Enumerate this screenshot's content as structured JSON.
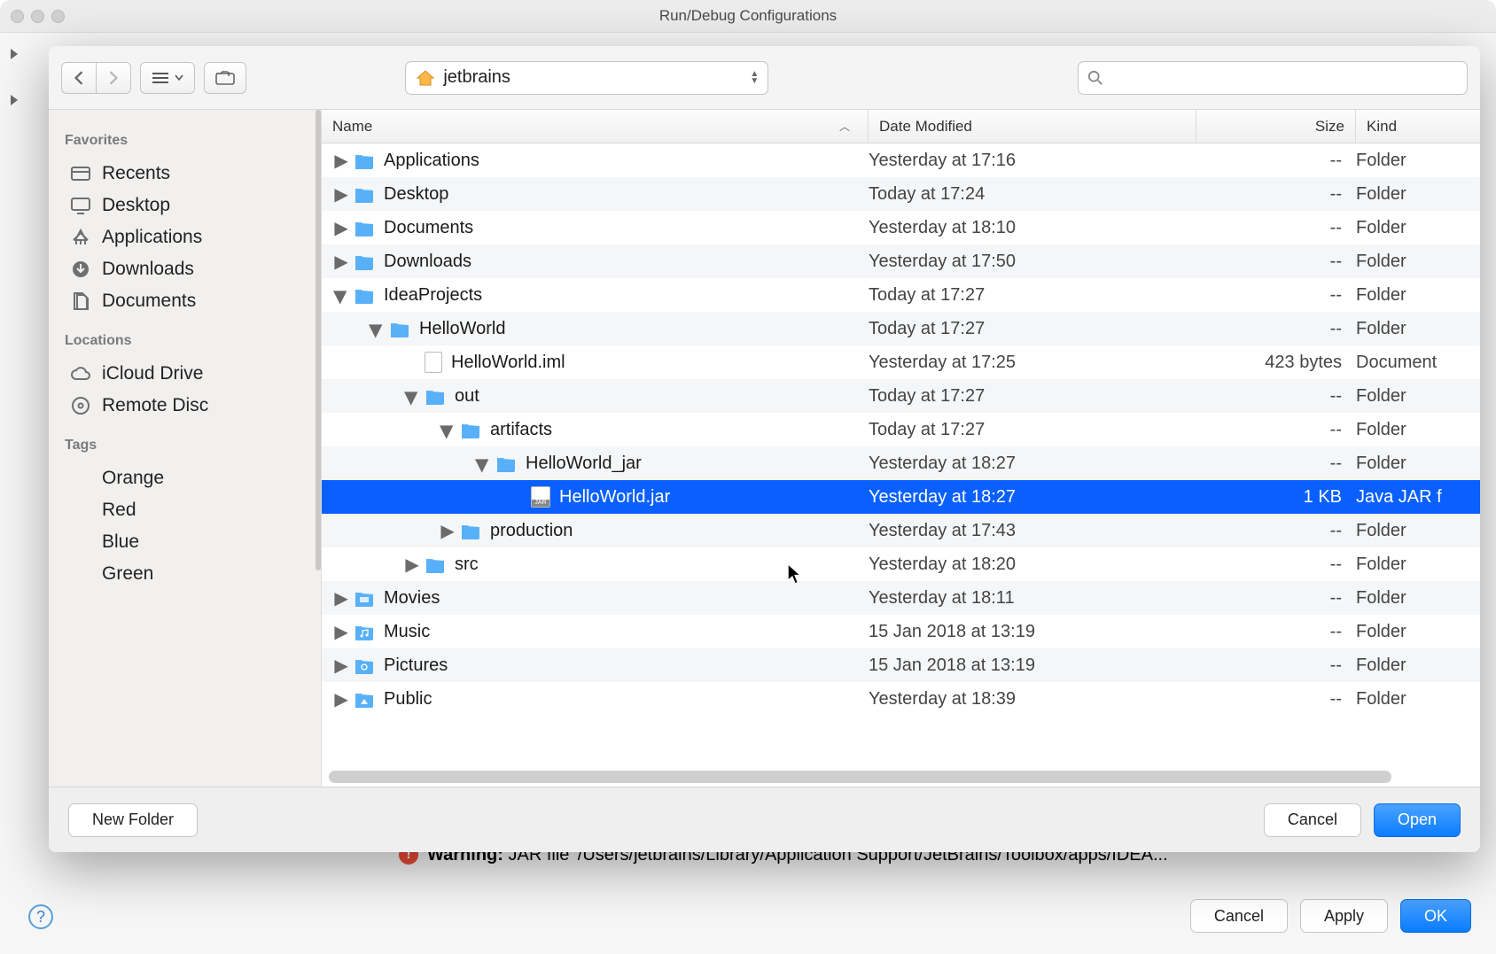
{
  "window": {
    "title": "Run/Debug Configurations",
    "right_clip": "n"
  },
  "toolbar": {
    "path_label": "jetbrains",
    "search_placeholder": ""
  },
  "sidebar": {
    "favorites_header": "Favorites",
    "favorites": [
      {
        "label": "Recents",
        "icon": "recents"
      },
      {
        "label": "Desktop",
        "icon": "desktop"
      },
      {
        "label": "Applications",
        "icon": "apps"
      },
      {
        "label": "Downloads",
        "icon": "downloads"
      },
      {
        "label": "Documents",
        "icon": "documents"
      }
    ],
    "locations_header": "Locations",
    "locations": [
      {
        "label": "iCloud Drive",
        "icon": "cloud"
      },
      {
        "label": "Remote Disc",
        "icon": "disc"
      }
    ],
    "tags_header": "Tags",
    "tags": [
      {
        "label": "Orange",
        "color": "#f5a623"
      },
      {
        "label": "Red",
        "color": "#ff3b30"
      },
      {
        "label": "Blue",
        "color": "#0a60ff"
      },
      {
        "label": "Green",
        "color": "#34c759"
      }
    ]
  },
  "columns": {
    "name": "Name",
    "date": "Date Modified",
    "size": "Size",
    "kind": "Kind"
  },
  "rows": [
    {
      "indent": 0,
      "disc": "closed",
      "icon": "folder",
      "name": "Applications",
      "date": "Yesterday at 17:16",
      "size": "--",
      "kind": "Folder"
    },
    {
      "indent": 0,
      "disc": "closed",
      "icon": "folder",
      "name": "Desktop",
      "date": "Today at 17:24",
      "size": "--",
      "kind": "Folder",
      "alt": true
    },
    {
      "indent": 0,
      "disc": "closed",
      "icon": "folder",
      "name": "Documents",
      "date": "Yesterday at 18:10",
      "size": "--",
      "kind": "Folder"
    },
    {
      "indent": 0,
      "disc": "closed",
      "icon": "folder",
      "name": "Downloads",
      "date": "Yesterday at 17:50",
      "size": "--",
      "kind": "Folder",
      "alt": true
    },
    {
      "indent": 0,
      "disc": "open",
      "icon": "folder",
      "name": "IdeaProjects",
      "date": "Today at 17:27",
      "size": "--",
      "kind": "Folder"
    },
    {
      "indent": 1,
      "disc": "open",
      "icon": "folder",
      "name": "HelloWorld",
      "date": "Today at 17:27",
      "size": "--",
      "kind": "Folder",
      "alt": true
    },
    {
      "indent": 2,
      "disc": "none",
      "icon": "doc",
      "name": "HelloWorld.iml",
      "date": "Yesterday at 17:25",
      "size": "423 bytes",
      "kind": "Document"
    },
    {
      "indent": 2,
      "disc": "open",
      "icon": "folder",
      "name": "out",
      "date": "Today at 17:27",
      "size": "--",
      "kind": "Folder",
      "alt": true
    },
    {
      "indent": 3,
      "disc": "open",
      "icon": "folder",
      "name": "artifacts",
      "date": "Today at 17:27",
      "size": "--",
      "kind": "Folder"
    },
    {
      "indent": 4,
      "disc": "open",
      "icon": "folder",
      "name": "HelloWorld_jar",
      "date": "Yesterday at 18:27",
      "size": "--",
      "kind": "Folder",
      "alt": true
    },
    {
      "indent": 5,
      "disc": "none",
      "icon": "jar",
      "name": "HelloWorld.jar",
      "date": "Yesterday at 18:27",
      "size": "1 KB",
      "kind": "Java JAR f",
      "selected": true
    },
    {
      "indent": 3,
      "disc": "closed",
      "icon": "folder",
      "name": "production",
      "date": "Yesterday at 17:43",
      "size": "--",
      "kind": "Folder",
      "alt": true
    },
    {
      "indent": 2,
      "disc": "closed",
      "icon": "folder",
      "name": "src",
      "date": "Yesterday at 18:20",
      "size": "--",
      "kind": "Folder"
    },
    {
      "indent": 0,
      "disc": "closed",
      "icon": "folder-movies",
      "name": "Movies",
      "date": "Yesterday at 18:11",
      "size": "--",
      "kind": "Folder",
      "alt": true
    },
    {
      "indent": 0,
      "disc": "closed",
      "icon": "folder-music",
      "name": "Music",
      "date": "15 Jan 2018 at 13:19",
      "size": "--",
      "kind": "Folder"
    },
    {
      "indent": 0,
      "disc": "closed",
      "icon": "folder-pictures",
      "name": "Pictures",
      "date": "15 Jan 2018 at 13:19",
      "size": "--",
      "kind": "Folder",
      "alt": true
    },
    {
      "indent": 0,
      "disc": "closed",
      "icon": "folder-public",
      "name": "Public",
      "date": "Yesterday at 18:39",
      "size": "--",
      "kind": "Folder"
    }
  ],
  "footer": {
    "new_folder": "New Folder",
    "cancel": "Cancel",
    "open": "Open"
  },
  "warning": {
    "label": "Warning:",
    "text": " JAR file '/Users/jetbrains/Library/Application Support/JetBrains/Toolbox/apps/IDEA..."
  },
  "bg_buttons": {
    "cancel": "Cancel",
    "apply": "Apply",
    "ok": "OK"
  }
}
